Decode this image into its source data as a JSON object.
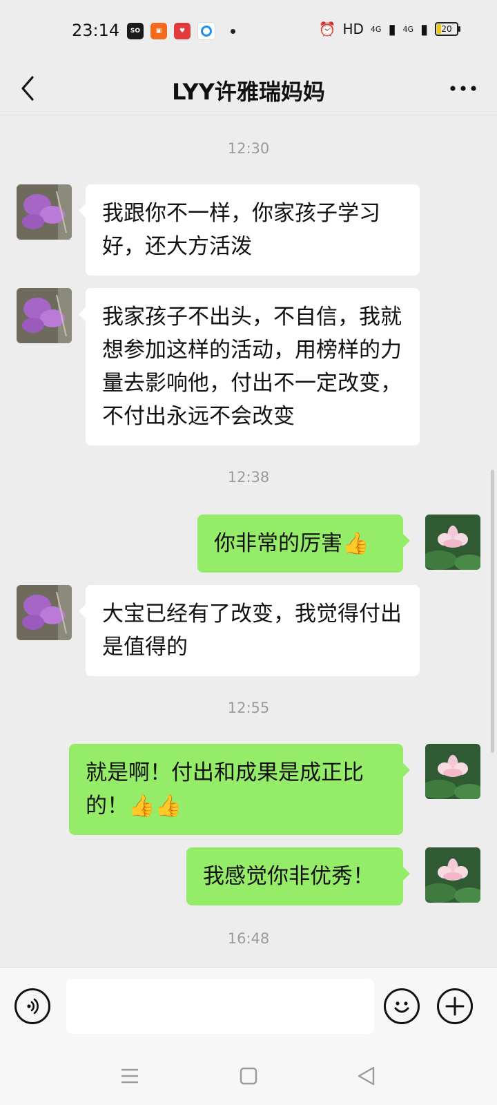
{
  "status_bar": {
    "time": "23:14",
    "network": "HD",
    "signal1": "4G",
    "signal2": "4G",
    "battery": "20"
  },
  "header": {
    "title": "LYY许雅瑞妈妈"
  },
  "messages": [
    {
      "type": "time",
      "text": "12:30"
    },
    {
      "type": "in",
      "text": "我跟你不一样，你家孩子学习好，还大方活泼"
    },
    {
      "type": "in",
      "text": "我家孩子不出头，不自信，我就想参加这样的活动，用榜样的力量去影响他，付出不一定改变，不付出永远不会改变"
    },
    {
      "type": "time",
      "text": "12:38"
    },
    {
      "type": "out",
      "text": "你非常的厉害",
      "emoji": "👍"
    },
    {
      "type": "in",
      "text": "大宝已经有了改变，我觉得付出是值得的"
    },
    {
      "type": "time",
      "text": "12:55"
    },
    {
      "type": "out",
      "text": "就是啊！付出和成果是成正比的！",
      "emoji": "👍👍"
    },
    {
      "type": "out",
      "text": "我感觉你非优秀！"
    },
    {
      "type": "time",
      "text": "16:48"
    }
  ],
  "input": {
    "value": "",
    "placeholder": ""
  },
  "icons": {
    "back": "back-arrow-icon",
    "more": "more-dots-icon",
    "voice": "voice-icon",
    "emoji": "emoji-icon",
    "plus": "plus-icon"
  },
  "colors": {
    "outgoing_bubble": "#95ec69",
    "incoming_bubble": "#ffffff",
    "background": "#ededed"
  }
}
